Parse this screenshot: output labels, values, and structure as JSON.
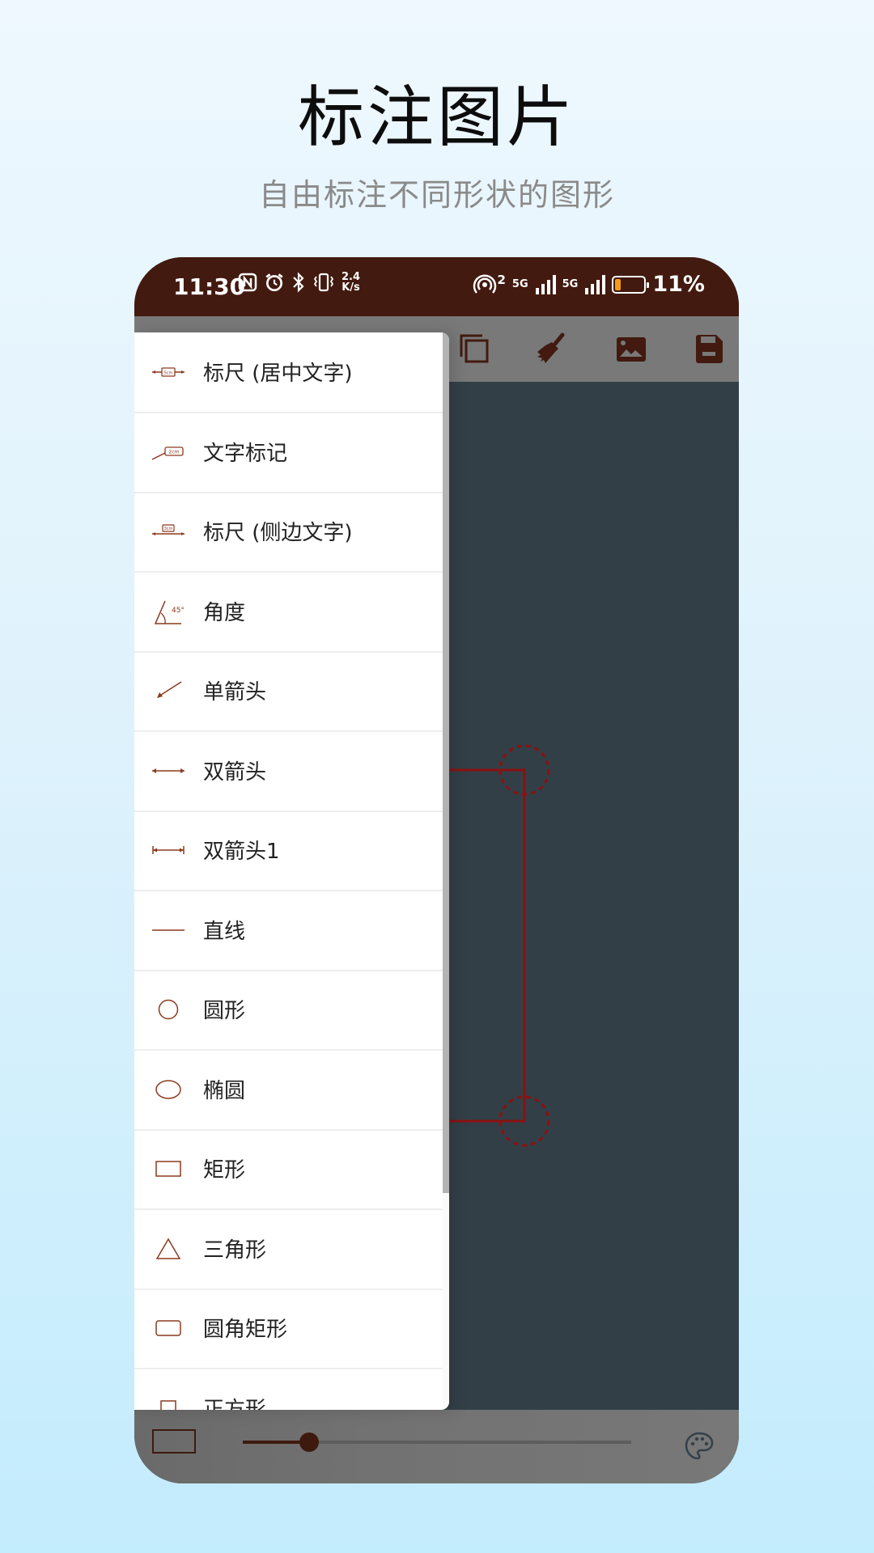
{
  "hero": {
    "title": "标注图片",
    "subtitle": "自由标注不同形状的图形"
  },
  "status_bar": {
    "time": "11:30",
    "left_icons": [
      "nfc-icon",
      "alarm-icon",
      "bluetooth-icon",
      "vibrate-icon"
    ],
    "net_speed_value": "2.4",
    "net_speed_unit": "K/s",
    "hotspot_count": "2",
    "sim1_label": "5G",
    "sim2_label": "5G",
    "battery_percent": "11%",
    "battery_level": 0.11,
    "battery_color": "#f59b1b"
  },
  "toolbar": {
    "icons": [
      "copy-icon",
      "clean-brush-icon",
      "image-icon",
      "save-icon"
    ]
  },
  "canvas": {
    "annotation_color": "#8a1212",
    "background": "#333f47"
  },
  "menu": {
    "items": [
      {
        "label": "标尺 (居中文字)",
        "icon": "ruler-center-text-icon",
        "icon_text": "5cm"
      },
      {
        "label": "文字标记",
        "icon": "text-marker-icon",
        "icon_text": "2cm"
      },
      {
        "label": "标尺 (侧边文字)",
        "icon": "ruler-side-text-icon",
        "icon_text": "3cm"
      },
      {
        "label": "角度",
        "icon": "angle-icon",
        "icon_text": "45°"
      },
      {
        "label": "单箭头",
        "icon": "single-arrow-icon"
      },
      {
        "label": "双箭头",
        "icon": "double-arrow-icon"
      },
      {
        "label": "双箭头1",
        "icon": "double-arrow-bar-icon"
      },
      {
        "label": "直线",
        "icon": "line-icon"
      },
      {
        "label": "圆形",
        "icon": "circle-icon"
      },
      {
        "label": "椭圆",
        "icon": "ellipse-icon"
      },
      {
        "label": "矩形",
        "icon": "rectangle-icon"
      },
      {
        "label": "三角形",
        "icon": "triangle-icon"
      },
      {
        "label": "圆角矩形",
        "icon": "rounded-rectangle-icon"
      },
      {
        "label": "正方形",
        "icon": "square-icon"
      }
    ],
    "accent_color": "#8b3a1e"
  },
  "bottom_bar": {
    "selected_shape": "rectangle",
    "stroke_width_fraction": 0.17,
    "accent_color": "#3e1a0e"
  }
}
